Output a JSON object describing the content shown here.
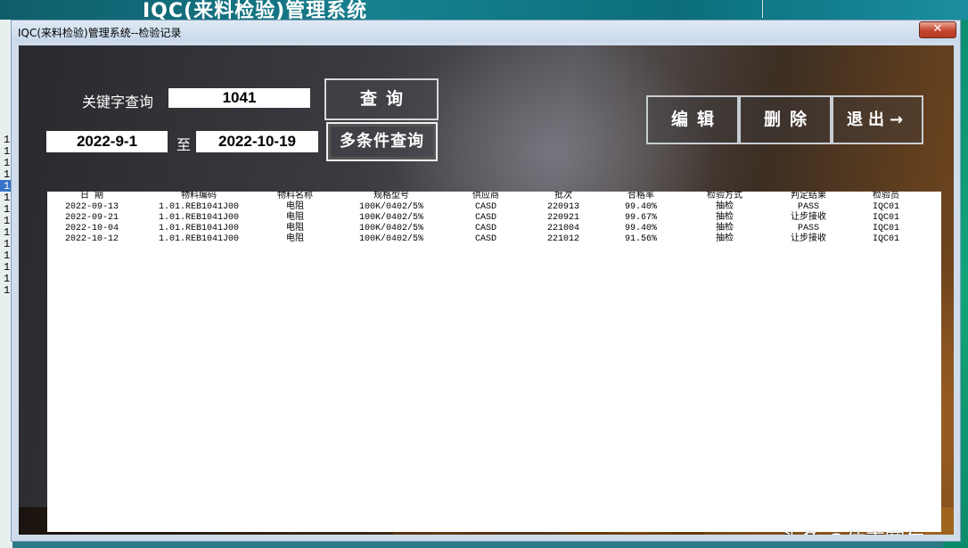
{
  "background_app": {
    "title": "IQC(来料检验)管理系统",
    "left_list": [
      "1",
      "1",
      "1",
      "1",
      "1",
      "1",
      "1",
      "1",
      "1",
      "1",
      "1",
      "1",
      "1",
      "1"
    ]
  },
  "window": {
    "title": "IQC(来料检验)管理系统--检验记录",
    "close_label": "✕"
  },
  "search": {
    "keyword_label": "关键字查询",
    "keyword_value": "1041",
    "query_button": "查询",
    "start_date": "2022-9-1",
    "to_label": "至",
    "end_date": "2022-10-19",
    "multi_query_button": "多条件查询"
  },
  "actions": {
    "edit_button": "编辑",
    "delete_button": "删除",
    "exit_button": "退出→"
  },
  "table": {
    "headers": [
      "日 期",
      "物料编码",
      "物料名称",
      "规格型号",
      "供应商",
      "批次",
      "合格率",
      "检验方式",
      "判定结果",
      "检验员"
    ],
    "rows": [
      [
        "2022-09-13",
        "1.01.REB1041J00",
        "电阻",
        "100K/0402/5%",
        "CASD",
        "220913",
        "99.40%",
        "抽检",
        "PASS",
        "IQC01"
      ],
      [
        "2022-09-21",
        "1.01.REB1041J00",
        "电阻",
        "100K/0402/5%",
        "CASD",
        "220921",
        "99.67%",
        "抽检",
        "让步接收",
        "IQC01"
      ],
      [
        "2022-10-04",
        "1.01.REB1041J00",
        "电阻",
        "100K/0402/5%",
        "CASD",
        "221004",
        "99.40%",
        "抽检",
        "PASS",
        "IQC01"
      ],
      [
        "2022-10-12",
        "1.01.REB1041J00",
        "电阻",
        "100K/0402/5%",
        "CASD",
        "221012",
        "91.56%",
        "抽检",
        "让步接收",
        "IQC01"
      ]
    ]
  },
  "watermark": "头条 @依克赛尔"
}
